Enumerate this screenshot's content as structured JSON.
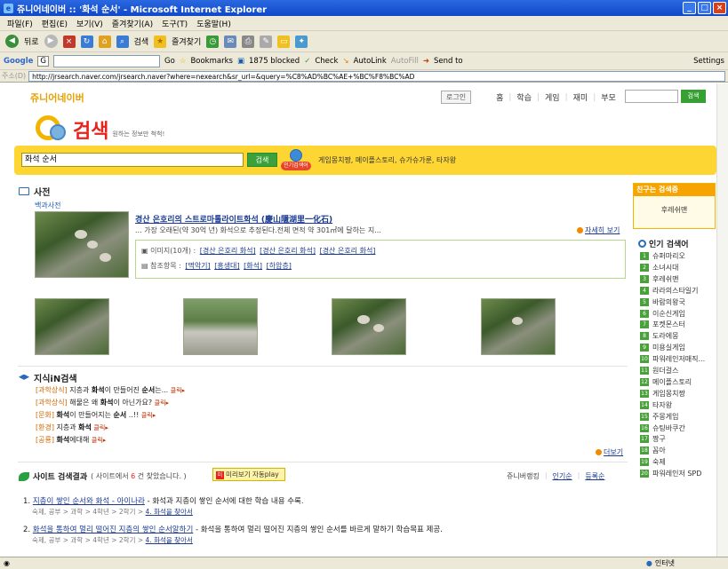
{
  "window": {
    "title": "쥬니어네이버 :: '화석 순서' - Microsoft Internet Explorer",
    "buttons": [
      "_",
      "□",
      "×"
    ]
  },
  "menu": [
    "파일(F)",
    "편집(E)",
    "보기(V)",
    "즐겨찾기(A)",
    "도구(T)",
    "도움말(H)"
  ],
  "toolbar": {
    "back": "뒤로",
    "search": "검색",
    "favorites": "즐겨찾기"
  },
  "googlebar": {
    "label": "Google",
    "g_button": "G",
    "go": "Go",
    "bookmarks": "Bookmarks",
    "blocked": "1875 blocked",
    "check": "Check",
    "autolink": "AutoLink",
    "autofill": "AutoFill",
    "sendto": "Send to",
    "settings": "Settings"
  },
  "address": {
    "label": "주소(D)",
    "url": "http://jrsearch.naver.com/jrsearch.naver?where=nexearch&sr_url=&query=%C8%AD%BC%AE+%BC%F8%BC%AD"
  },
  "status": {
    "zone": "인터넷"
  },
  "header": {
    "logo": "쥬니어네이버",
    "login": "로그인",
    "nav": [
      "홈",
      "학습",
      "게임",
      "재미",
      "부모"
    ],
    "separator": "|",
    "search_button": "검색",
    "brand": "검색",
    "slogan": "원하는 정보만 척척!"
  },
  "main_search": {
    "value": "화석 순서",
    "button": "검색",
    "hot_label": "인기검색어",
    "hot_terms": "게임몽치짱, 메이플스토리, 슈가슈가룬, 타자왕"
  },
  "dictionary": {
    "title": "사전",
    "subtitle": "백과사전",
    "entry_title": "경산 은호리의 스트로마톨라이트화석 (慶山隱湖里一化石)",
    "entry_desc": "... 가장 오래된(약 30억 년) 화석으로 추정된다.전체 면적 약 301㎡에 달하는 지...",
    "more": "자세히 보기",
    "images_label": "이미지(10개) :",
    "image_links": [
      "[경산 은호리 화석]",
      "[경산 은호리 화석]",
      "[경산 은호리 화석]"
    ],
    "refs_label": "참조항목 :",
    "ref_links": [
      "[멱악기]",
      "[흥생대]",
      "[화석]",
      "[하암층]"
    ]
  },
  "knowledge": {
    "title": "지식iN검색",
    "click": "클릭",
    "more": "더보기",
    "items": [
      {
        "cat": "[과학상식]",
        "pre": "지층과 ",
        "key": "화석",
        "mid": "이 만들어진 ",
        "key2": "순서",
        "post": "는..."
      },
      {
        "cat": "[과학상식]",
        "pre": "해물은 왜 ",
        "key": "화석",
        "mid": "이 아닌가요?",
        "key2": "",
        "post": ""
      },
      {
        "cat": "[문화]",
        "pre": "",
        "key": "화석",
        "mid": "이 만들어지는 ",
        "key2": "순서",
        "post": " ..!!"
      },
      {
        "cat": "[환경]",
        "pre": "지층과 ",
        "key": "화석",
        "mid": "",
        "key2": "",
        "post": ""
      },
      {
        "cat": "[공룡]",
        "pre": "",
        "key": "화석",
        "mid": "에대해",
        "key2": "",
        "post": ""
      }
    ]
  },
  "site_results": {
    "title": "사이트 검색결과",
    "count_pre": "( 사이트에서 ",
    "count": "6",
    "count_post": " 건 찾았습니다. )",
    "preview_icon": "미",
    "preview_btn": "미리보기 자동play",
    "sort": [
      "쥬니버랭킹",
      "인기순",
      "등록순"
    ],
    "results": [
      {
        "num": "1.",
        "title": "지층이 쌓인 순서와 화석 - 아이나라",
        "desc": " - 화석과 지층이 쌓인 순서에 대한 학습 내용 수록.",
        "crumb": "숙제, 공부 > 과학 > 4학년 > 2학기 >",
        "crumb_link": "4. 화석을 찾아서"
      },
      {
        "num": "2.",
        "title": "화석을 통하여 멀리 떨어진 지층의 쌓인 순서알하기",
        "desc": " - 화석을 통하여 멀리 떨어진 지층의 쌓인 순서를 바르게 말하기 학습목표 제공.",
        "crumb": "숙제, 공부 > 과학 > 4학년 > 2학기 >",
        "crumb_link": "4. 화석을 찾아서"
      }
    ]
  },
  "sidebar": {
    "friends_title": "친구는 검색중",
    "friends_item": "후레쉬맨",
    "popular_title": "인기 검색어",
    "popular": [
      {
        "rank": "1",
        "term": "슈퍼마리오"
      },
      {
        "rank": "2",
        "term": "소녀시대"
      },
      {
        "rank": "3",
        "term": "후레쉬맨"
      },
      {
        "rank": "4",
        "term": "라라의스타일기"
      },
      {
        "rank": "5",
        "term": "바람의왕국"
      },
      {
        "rank": "6",
        "term": "이순신게임"
      },
      {
        "rank": "7",
        "term": "포켓몬스터"
      },
      {
        "rank": "8",
        "term": "도라에몽"
      },
      {
        "rank": "9",
        "term": "미용실게임"
      },
      {
        "rank": "10",
        "term": "파워레인저매직..."
      },
      {
        "rank": "11",
        "term": "원더걸스"
      },
      {
        "rank": "12",
        "term": "메이플스토리"
      },
      {
        "rank": "13",
        "term": "게임몽치짱"
      },
      {
        "rank": "14",
        "term": "타자왕"
      },
      {
        "rank": "15",
        "term": "주몽게임"
      },
      {
        "rank": "16",
        "term": "슈팅바쿠간"
      },
      {
        "rank": "17",
        "term": "짱구"
      },
      {
        "rank": "18",
        "term": "꼼아"
      },
      {
        "rank": "19",
        "term": "숙제"
      },
      {
        "rank": "20",
        "term": "파워레인저 SPD"
      }
    ]
  }
}
